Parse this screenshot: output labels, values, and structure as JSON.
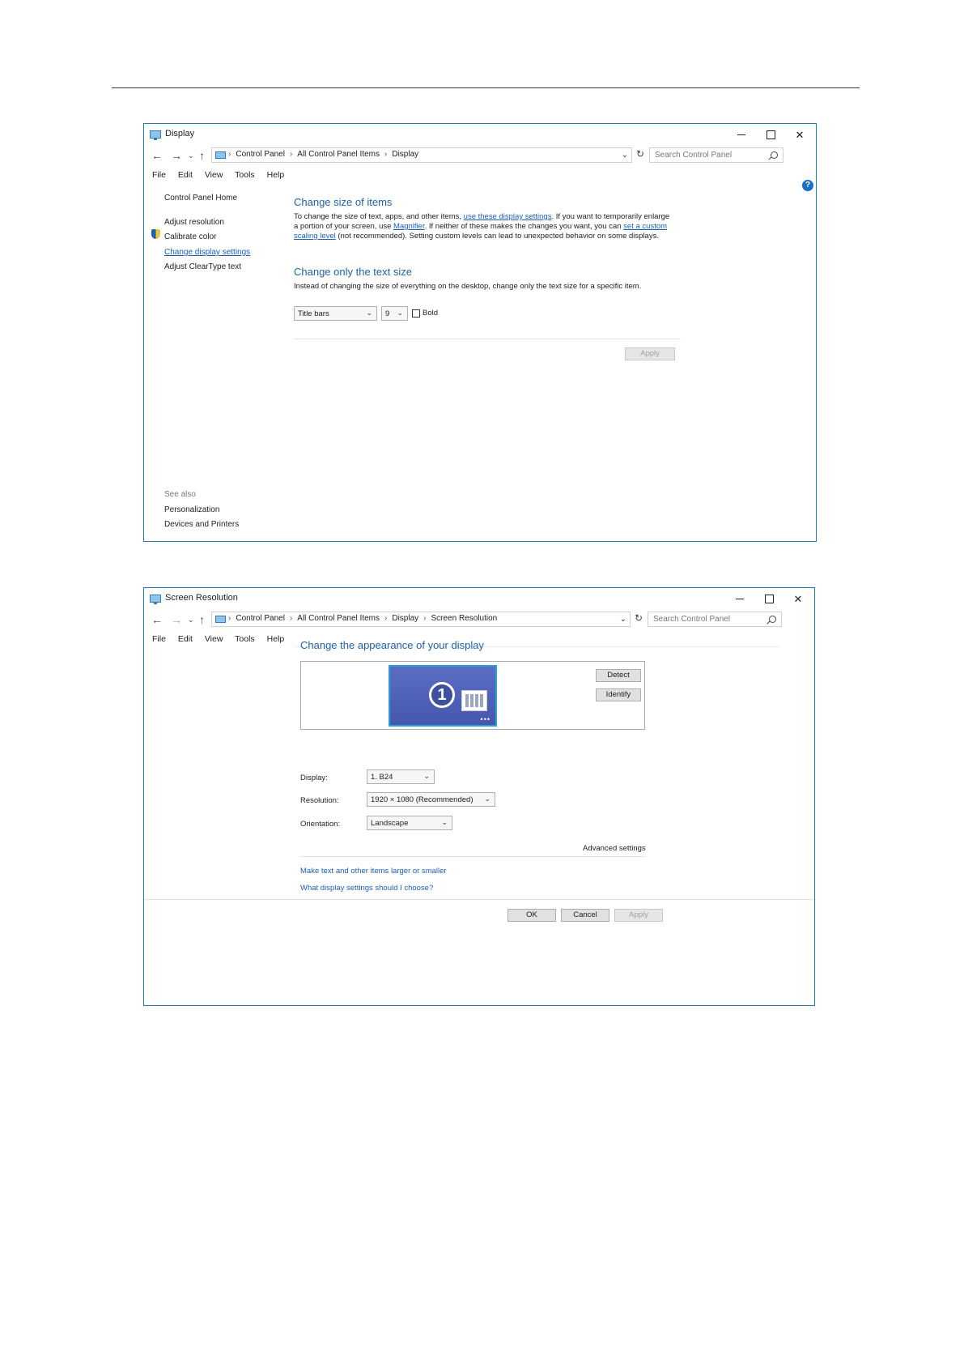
{
  "window1": {
    "title": "Display",
    "address": {
      "crumbs": [
        "Control Panel",
        "All Control Panel Items",
        "Display"
      ]
    },
    "search_placeholder": "Search Control Panel",
    "menu": [
      "File",
      "Edit",
      "View",
      "Tools",
      "Help"
    ],
    "sidebar": {
      "home": "Control Panel Home",
      "items": [
        "Adjust resolution",
        "Calibrate color",
        "Change display settings",
        "Adjust ClearType text"
      ],
      "see_also": "See also",
      "see_also_items": [
        "Personalization",
        "Devices and Printers"
      ]
    },
    "section1": {
      "heading": "Change size of items",
      "line1_a": "To change the size of text, apps, and other items, ",
      "line1_link": "use these display settings",
      "line1_b": ". If you want to temporarily enlarge",
      "line2_a": "a portion of your screen, use ",
      "line2_link1": "Magnifier",
      "line2_b": ". If neither of these makes the changes you want, you can ",
      "line2_link2": "set a custom",
      "line3_link": "scaling level",
      "line3_b": " (not recommended). Setting custom levels can lead to unexpected behavior on some displays."
    },
    "section2": {
      "heading": "Change only the text size",
      "desc": "Instead of changing the size of everything on the desktop, change only the text size for a specific item.",
      "item_select": "Title bars",
      "size_select": "9",
      "bold_label": "Bold",
      "apply": "Apply"
    }
  },
  "window2": {
    "title": "Screen Resolution",
    "address": {
      "crumbs": [
        "Control Panel",
        "All Control Panel Items",
        "Display",
        "Screen Resolution"
      ]
    },
    "search_placeholder": "Search Control Panel",
    "menu": [
      "File",
      "Edit",
      "View",
      "Tools",
      "Help"
    ],
    "heading": "Change the appearance of your display",
    "monitor_number": "1",
    "detect": "Detect",
    "identify": "Identify",
    "display_label": "Display:",
    "display_value": "1. B24",
    "resolution_label": "Resolution:",
    "resolution_value": "1920 × 1080 (Recommended)",
    "orientation_label": "Orientation:",
    "orientation_value": "Landscape",
    "advanced": "Advanced settings",
    "link1": "Make text and other items larger or smaller",
    "link2": "What display settings should I choose?",
    "ok": "OK",
    "cancel": "Cancel",
    "apply": "Apply"
  }
}
